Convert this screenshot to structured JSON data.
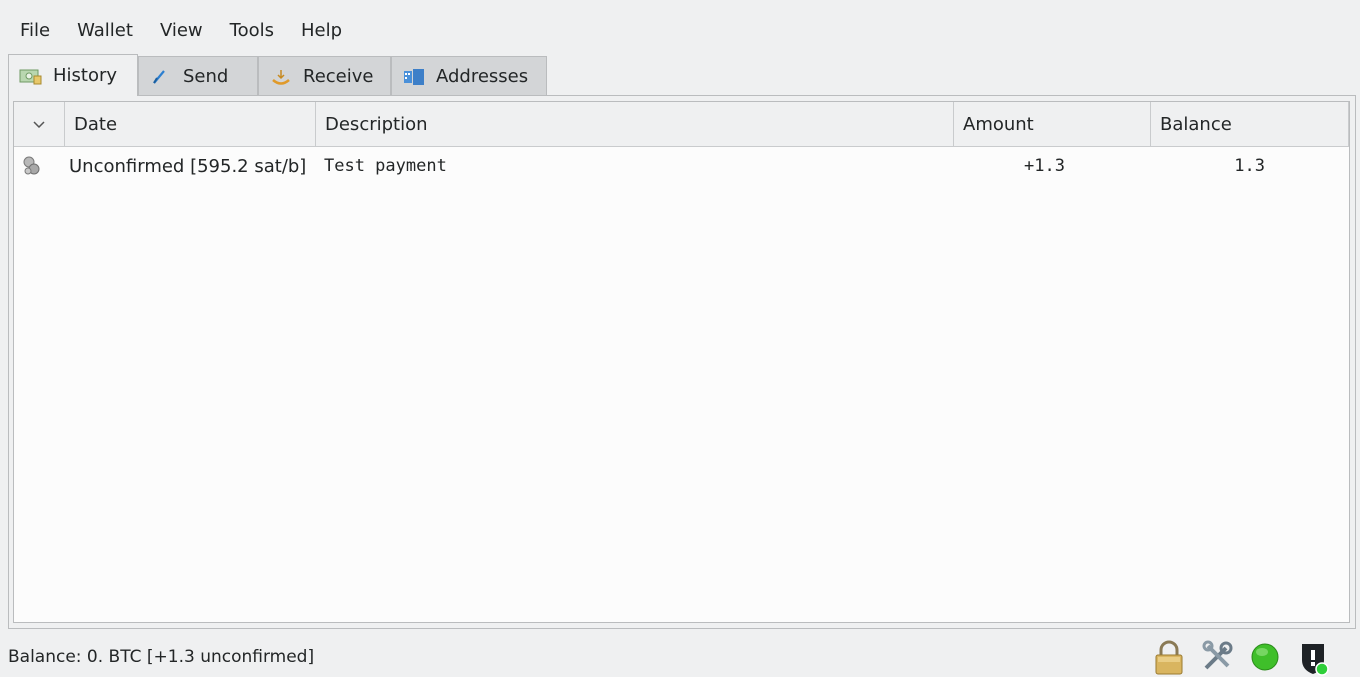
{
  "menu": [
    "File",
    "Wallet",
    "View",
    "Tools",
    "Help"
  ],
  "tabs": [
    {
      "label": "History",
      "icon": "history-icon",
      "active": true
    },
    {
      "label": "Send",
      "icon": "send-icon",
      "active": false
    },
    {
      "label": "Receive",
      "icon": "receive-icon",
      "active": false
    },
    {
      "label": "Addresses",
      "icon": "addresses-icon",
      "active": false
    }
  ],
  "history": {
    "columns": [
      "",
      "Date",
      "Description",
      "Amount",
      "Balance"
    ],
    "rows": [
      {
        "status_icon": "unconfirmed-icon",
        "date": "Unconfirmed [595.2 sat/b]",
        "description": "Test payment",
        "amount": "+1.3",
        "balance": "1.3"
      }
    ]
  },
  "status": {
    "balance_text": "Balance: 0. BTC  [+1.3 unconfirmed]",
    "icons": [
      "lock-icon",
      "preferences-icon",
      "network-status-icon",
      "seed-icon"
    ],
    "network_color": "#3fbf2a"
  }
}
